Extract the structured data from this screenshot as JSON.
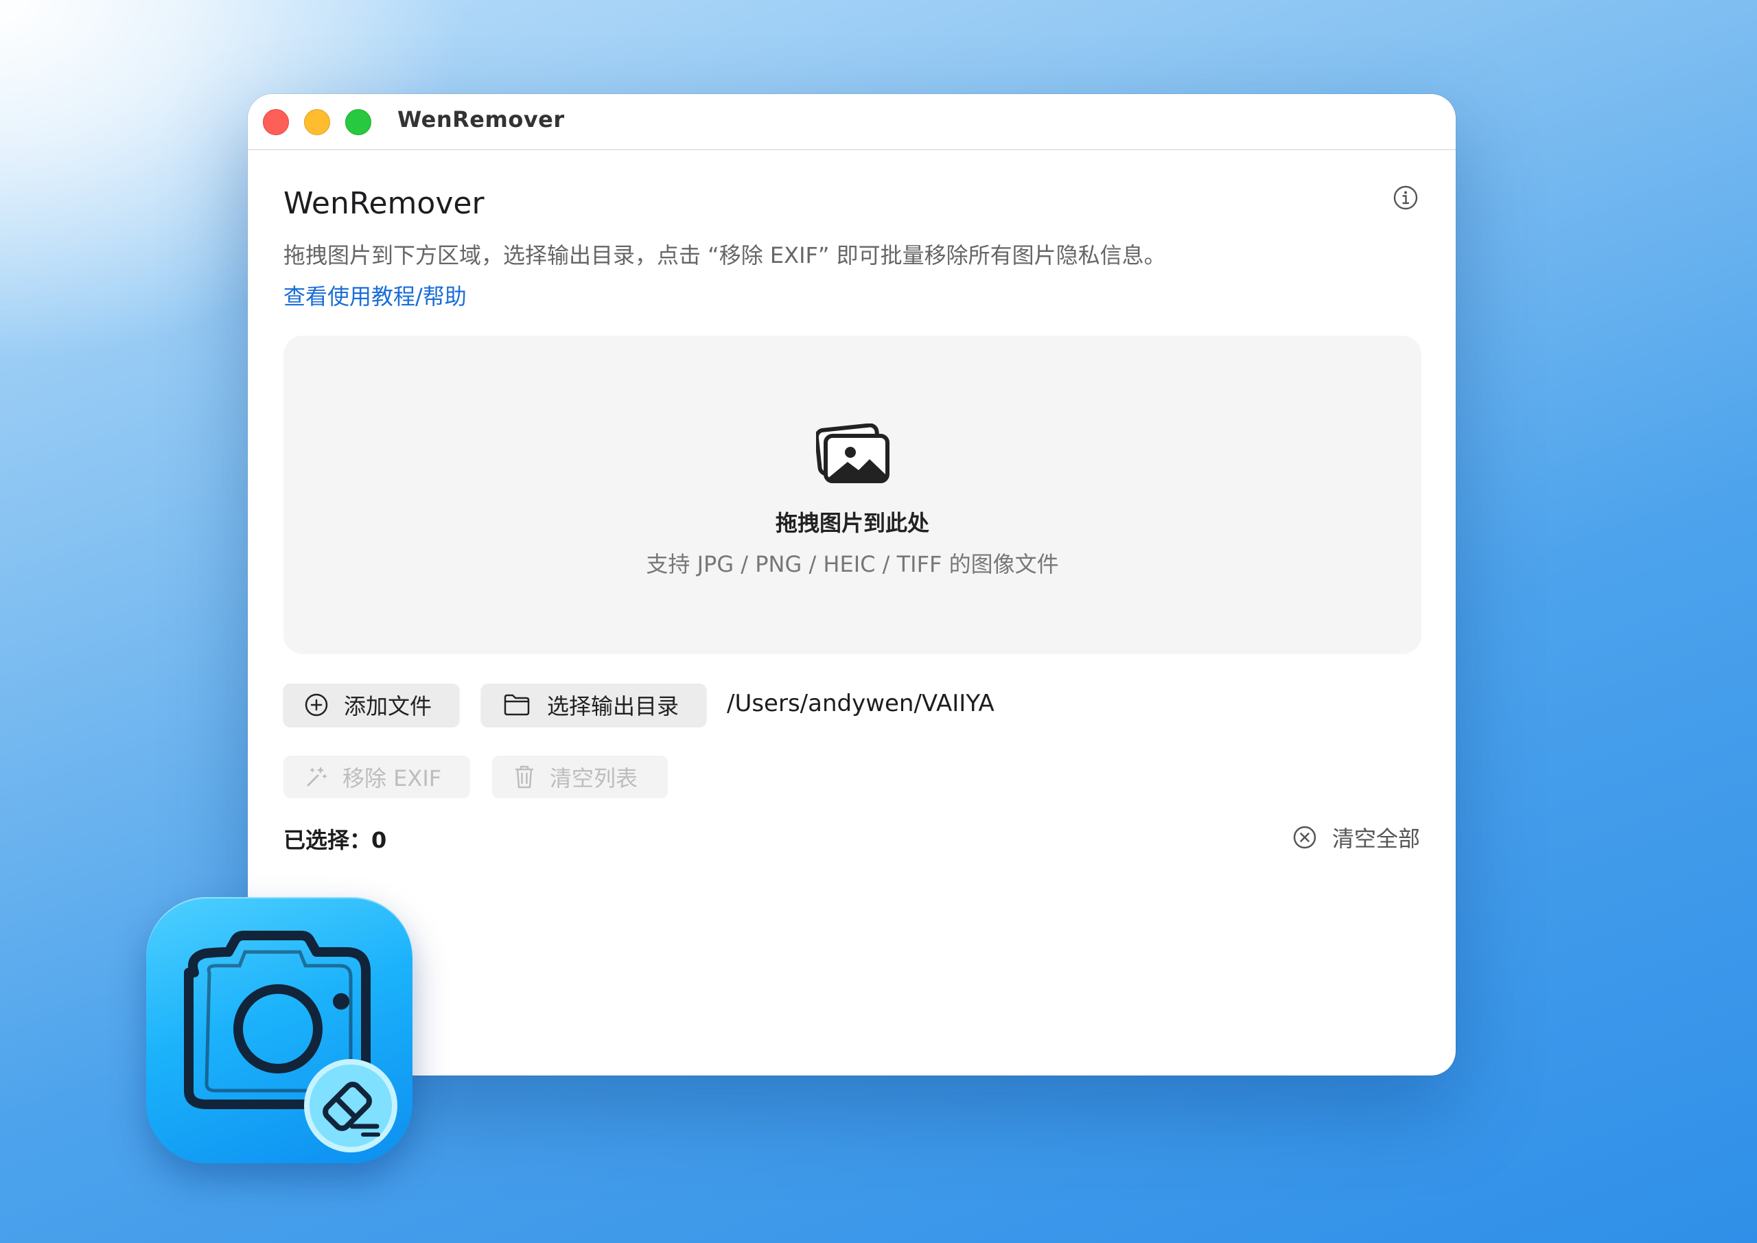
{
  "window": {
    "title": "WenRemover"
  },
  "header": {
    "app_title": "WenRemover",
    "description": "拖拽图片到下方区域，选择输出目录，点击 “移除 EXIF” 即可批量移除所有图片隐私信息。",
    "help_link": "查看使用教程/帮助",
    "info_icon": "info-circle-icon"
  },
  "dropzone": {
    "icon": "photos-stack-icon",
    "title": "拖拽图片到此处",
    "subtitle": "支持 JPG / PNG / HEIC / TIFF 的图像文件"
  },
  "toolbar": {
    "add_files_label": "添加文件",
    "choose_output_label": "选择输出目录",
    "output_path": "/Users/andywen/VAIIYA",
    "remove_exif_label": "移除 EXIF",
    "clear_list_label": "清空列表"
  },
  "footer": {
    "selected_label": "已选择：",
    "selected_count": "0",
    "clear_all_label": "清空全部"
  },
  "colors": {
    "accent_link": "#1a6ed8",
    "close": "#fe5f57",
    "minimize": "#febc2e",
    "zoom": "#28c840"
  }
}
